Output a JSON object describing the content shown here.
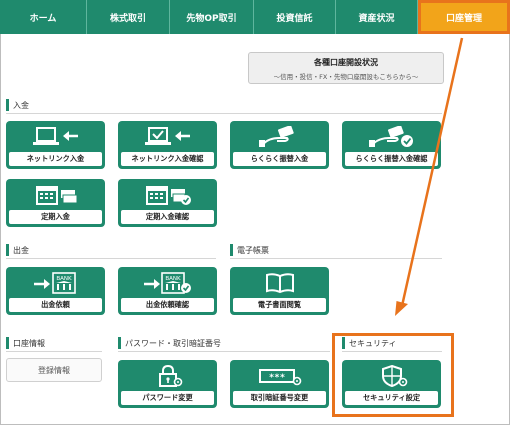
{
  "nav": {
    "tabs": [
      {
        "label": "ホーム"
      },
      {
        "label": "株式取引"
      },
      {
        "label": "先物OP取引"
      },
      {
        "label": "投資信託"
      },
      {
        "label": "資産状況"
      },
      {
        "label": "口座管理",
        "active": true
      }
    ]
  },
  "status_button": {
    "title": "各種口座開設状況",
    "subtitle": "～信用・投信・FX・先物口座開設もこちらから～"
  },
  "sections": {
    "deposit": "入金",
    "withdraw": "出金",
    "ebook": "電子帳票",
    "account_info": "口座情報",
    "password": "パスワード・取引暗証番号",
    "security": "セキュリティ"
  },
  "tiles": {
    "netlink_deposit": "ネットリンク入金",
    "netlink_deposit_confirm": "ネットリンク入金確認",
    "rakuraku_transfer": "らくらく振替入金",
    "rakuraku_transfer_confirm": "らくらく振替入金確認",
    "fixed_deposit": "定期入金",
    "fixed_deposit_confirm": "定期入金確認",
    "withdraw_request": "出金依頼",
    "withdraw_request_confirm": "出金依頼確認",
    "ebook_view": "電子書面閲覧",
    "password_change": "パスワード変更",
    "pin_change": "取引暗証番号変更",
    "security_settings": "セキュリティ設定"
  },
  "registration_info": "登録情報",
  "icons": {
    "bank_label": "BANK",
    "pin_mask": "***"
  },
  "colors": {
    "brand_green": "#1f8a6d",
    "active_tab": "#f2a41a",
    "highlight_orange": "#e8731c"
  }
}
